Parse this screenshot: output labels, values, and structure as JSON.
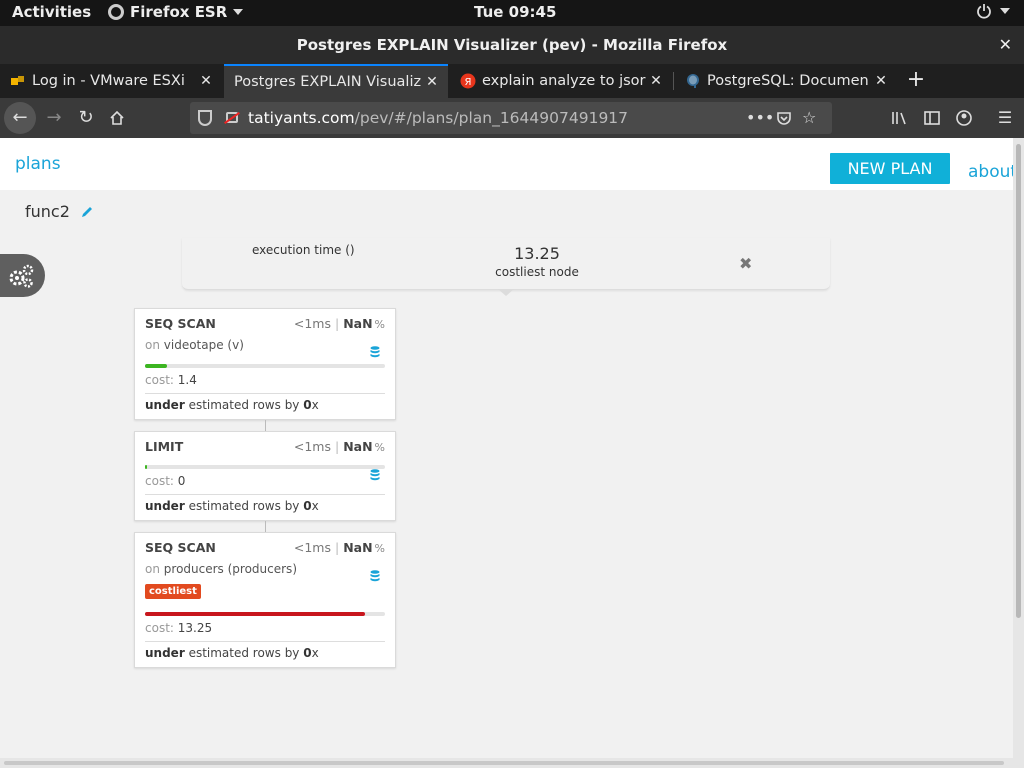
{
  "topbar": {
    "activities": "Activities",
    "app_name": "Firefox ESR",
    "clock": "Tue 09:45"
  },
  "window": {
    "title": "Postgres EXPLAIN Visualizer (pev) - Mozilla Firefox"
  },
  "tabs": [
    {
      "label": "Log in - VMware ESXi",
      "icon": "vmware-icon",
      "active": false
    },
    {
      "label": "Postgres EXPLAIN Visualiz",
      "icon": "none",
      "active": true
    },
    {
      "label": "explain analyze to jsor",
      "icon": "yandex-icon",
      "active": false
    },
    {
      "label": "PostgreSQL: Documen",
      "icon": "postgresql-elephant-icon",
      "active": false
    }
  ],
  "urlbar": {
    "domain": "tatiyants.com",
    "path": "/pev/#/plans/plan_1644907491917"
  },
  "pev": {
    "plans_link": "plans",
    "new_plan_button": "NEW PLAN",
    "about_link": "about",
    "plan_title": "func2",
    "summary": {
      "execution_time_label": "execution time ()",
      "costliest_value": "13.25",
      "costliest_label": "costliest node"
    },
    "nodes": [
      {
        "type": "SEQ SCAN",
        "time": "<1ms",
        "pct_value": "NaN",
        "pct_sign": "%",
        "on_label": "on",
        "relation": "videotape (v)",
        "cost_label": "cost:",
        "cost": "1.4",
        "bar_fraction": 0.09,
        "bar_color": "#3cb521",
        "est_prefix": "under",
        "est_middle": "estimated rows by",
        "est_factor": "0",
        "est_suffix": "x"
      },
      {
        "type": "LIMIT",
        "time": "<1ms",
        "pct_value": "NaN",
        "pct_sign": "%",
        "cost_label": "cost:",
        "cost": "0",
        "bar_fraction": 0.005,
        "bar_color": "#3cb521",
        "est_prefix": "under",
        "est_middle": "estimated rows by",
        "est_factor": "0",
        "est_suffix": "x"
      },
      {
        "type": "SEQ SCAN",
        "time": "<1ms",
        "pct_value": "NaN",
        "pct_sign": "%",
        "on_label": "on",
        "relation": "producers (producers)",
        "badge": "costliest",
        "cost_label": "cost:",
        "cost": "13.25",
        "bar_fraction": 0.917,
        "bar_color": "#c8161d",
        "est_prefix": "under",
        "est_middle": "estimated rows by",
        "est_factor": "0",
        "est_suffix": "x"
      }
    ]
  },
  "colors": {
    "accent": "#1aa4d8",
    "button": "#10b0d8",
    "costliest_badge": "#e24a1f",
    "db_icon": "#1aa4d8"
  }
}
